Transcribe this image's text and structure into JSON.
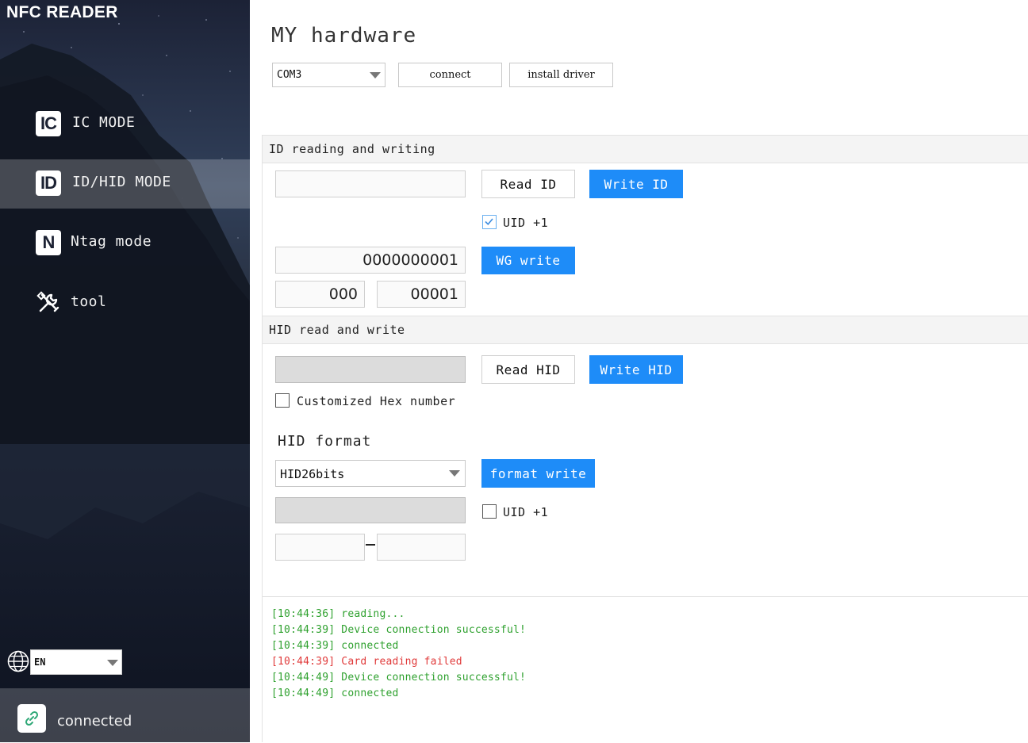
{
  "app": {
    "title": "NFC READER"
  },
  "sidebar": {
    "items": [
      {
        "icon": "ic-icon",
        "icon_text": "IC",
        "label": "IC MODE",
        "active": false
      },
      {
        "icon": "id-icon",
        "icon_text": "ID",
        "label": "ID/HID MODE",
        "active": true
      },
      {
        "icon": "n-icon",
        "icon_text": "N",
        "label": "Ntag mode",
        "active": false
      },
      {
        "icon": "tools-icon",
        "icon_text": "",
        "label": "tool",
        "active": false
      }
    ],
    "language": {
      "icon": "globe-icon",
      "value": "EN"
    },
    "status": {
      "icon": "link-icon",
      "label": "connected"
    }
  },
  "main": {
    "title": "MY hardware",
    "port": {
      "value": "COM3"
    },
    "connect_label": "connect",
    "install_driver_label": "install driver",
    "id_section": {
      "header": "ID reading and writing",
      "id_input": "",
      "read_label": "Read ID",
      "write_label": "Write ID",
      "uid_label": "UID +1",
      "uid_checked": true,
      "wg_value": "0000000001",
      "wg_write_label": "WG write",
      "facility_value": "000",
      "card_value": "00001"
    },
    "hid_section": {
      "header": "HID read and write",
      "hid_input": "",
      "read_label": "Read HID",
      "write_label": "Write HID",
      "custom_hex_label": "Customized Hex number",
      "custom_hex_checked": false,
      "format_title": "HID format",
      "format_value": "HID26bits",
      "format_write_label": "format write",
      "uid_label": "UID +1",
      "uid_checked": false,
      "format_input": "",
      "range_from": "",
      "range_to": ""
    },
    "log": [
      {
        "time": "[10:44:36]",
        "text": "reading...",
        "level": "ok"
      },
      {
        "time": "[10:44:39]",
        "text": "Device connection successful!",
        "level": "ok"
      },
      {
        "time": "[10:44:39]",
        "text": "connected",
        "level": "ok"
      },
      {
        "time": "[10:44:39]",
        "text": "Card reading failed",
        "level": "error"
      },
      {
        "time": "[10:44:49]",
        "text": "Device connection successful!",
        "level": "ok"
      },
      {
        "time": "[10:44:49]",
        "text": "connected",
        "level": "ok"
      }
    ]
  },
  "colors": {
    "accent": "#1e8cf8",
    "log_ok": "#2fa12f",
    "log_error": "#e03a3a",
    "sidebar_bg": "#1f2638"
  }
}
